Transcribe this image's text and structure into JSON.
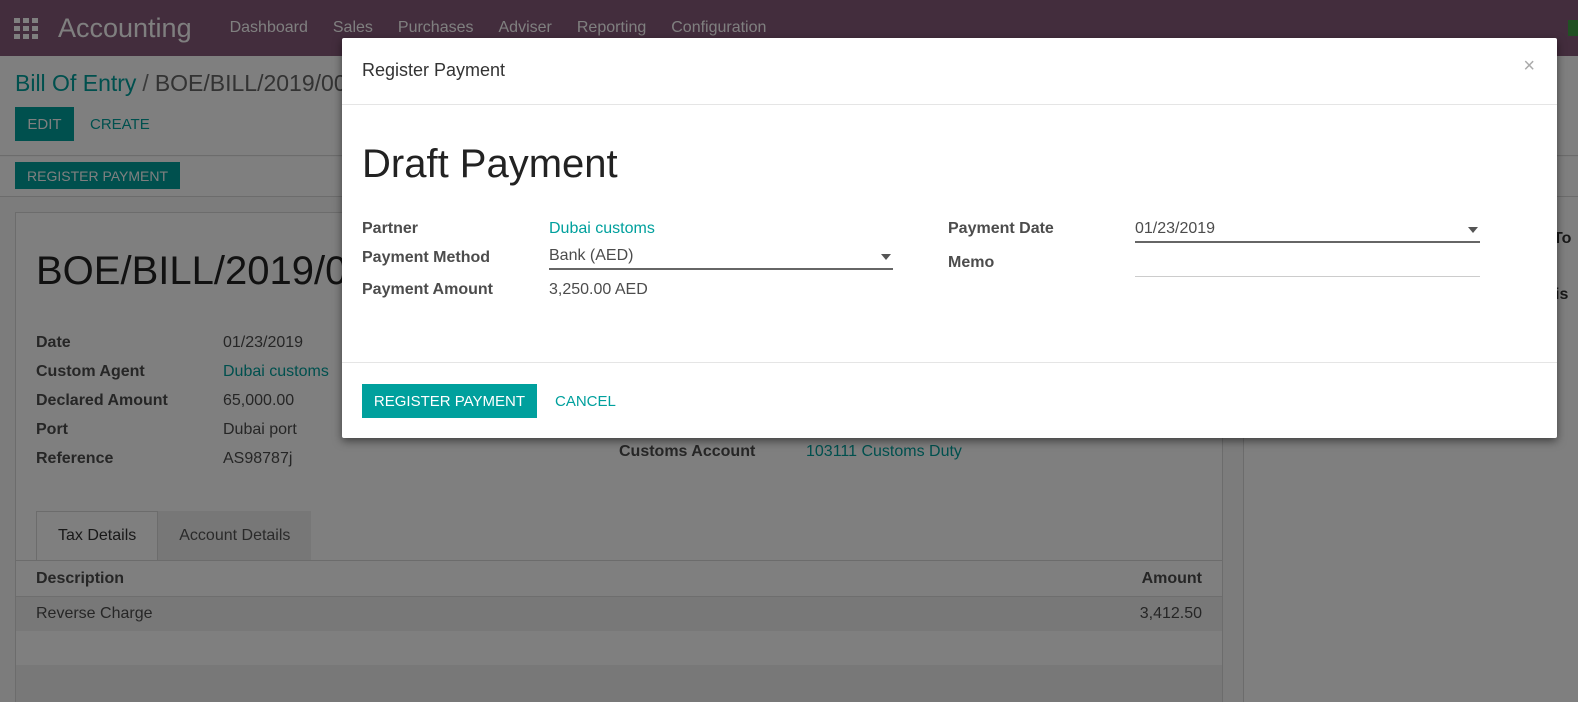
{
  "navbar": {
    "app_name": "Accounting",
    "menu": [
      "Dashboard",
      "Sales",
      "Purchases",
      "Adviser",
      "Reporting",
      "Configuration"
    ]
  },
  "breadcrumb": {
    "parent": "Bill Of Entry",
    "separator": "/",
    "current": "BOE/BILL/2019/00"
  },
  "control_panel": {
    "edit_label": "EDIT",
    "create_label": "CREATE"
  },
  "statusbar": {
    "register_payment_label": "REGISTER PAYMENT"
  },
  "form": {
    "record_title": "BOE/BILL/2019/0",
    "fields": [
      {
        "label": "Date",
        "value": "01/23/2019"
      },
      {
        "label": "Custom Agent",
        "value": "Dubai customs"
      },
      {
        "label": "Declared Amount",
        "value": "65,000.00"
      },
      {
        "label": "Port",
        "value": "Dubai port"
      },
      {
        "label": "Reference",
        "value": "AS98787j"
      }
    ],
    "customs_account": {
      "label": "Customs Account",
      "value": "103111 Customs Duty"
    },
    "tabs": [
      "Tax Details",
      "Account Details"
    ],
    "table": {
      "columns": [
        "Description",
        "Amount"
      ],
      "rows": [
        {
          "description": "Reverse Charge",
          "amount": "3,412.50"
        }
      ]
    }
  },
  "side_pane": {
    "fragment_1": "To",
    "fragment_2": "is"
  },
  "modal": {
    "title": "Register Payment",
    "close_glyph": "×",
    "heading": "Draft Payment",
    "partner": {
      "label": "Partner",
      "value": "Dubai customs"
    },
    "payment_method": {
      "label": "Payment Method",
      "value": "Bank (AED)"
    },
    "payment_amount": {
      "label": "Payment Amount",
      "value": "3,250.00 AED"
    },
    "payment_date": {
      "label": "Payment Date",
      "value": "01/23/2019"
    },
    "memo": {
      "label": "Memo",
      "value": ""
    },
    "register_label": "REGISTER PAYMENT",
    "cancel_label": "CANCEL"
  },
  "colors": {
    "navbar": "#875a7b",
    "accent": "#00a09d"
  }
}
